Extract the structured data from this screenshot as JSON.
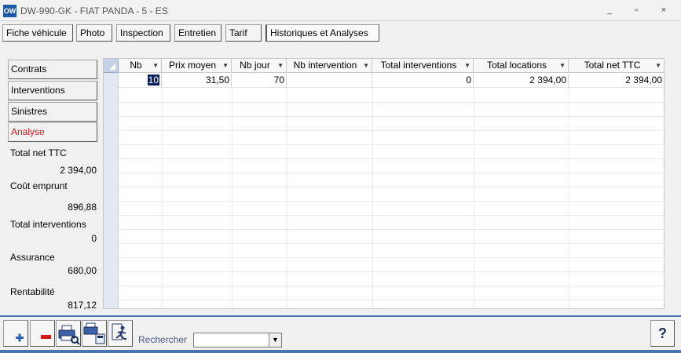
{
  "window": {
    "icon_label": "OW",
    "title": "DW-990-GK - FIAT PANDA - 5 - ES",
    "controls": [
      "_",
      "▫",
      "×"
    ]
  },
  "tabs": [
    {
      "label": "Fiche véhicule"
    },
    {
      "label": "Photo"
    },
    {
      "label": "Inspection"
    },
    {
      "label": "Entretien"
    },
    {
      "label": "Tarif"
    },
    {
      "label": "Historiques et Analyses"
    }
  ],
  "active_tab": "Historiques et Analyses",
  "side_buttons": [
    {
      "label": "Contrats"
    },
    {
      "label": "Interventions"
    },
    {
      "label": "Sinistres"
    },
    {
      "label": "Analyse"
    }
  ],
  "active_side_button": "Analyse",
  "summary": {
    "total_net_label": "Total net TTC",
    "total_net_value": "2 394,00",
    "cout_emprunt_label": "Coût emprunt",
    "cout_emprunt_value": "896,88",
    "total_interventions_label": "Total interventions",
    "total_interventions_value": "0",
    "assurance_label": "Assurance",
    "assurance_value": "680,00",
    "rentabilite_label": "Rentabilité",
    "rentabilite_value": "817,12"
  },
  "table": {
    "columns": [
      "Nb",
      "Prix moyen",
      "Nb jour",
      "Nb intervention",
      "Total interventions",
      "Total locations",
      "Total net TTC"
    ],
    "rows": [
      [
        "10",
        "31,50",
        "70",
        "",
        "0",
        "2 394,00",
        "2 394,00"
      ]
    ]
  },
  "toolbar": {
    "search_label": "Rechercher",
    "search_value": "",
    "help_label": "?"
  },
  "colors": {
    "accent": "#4a73b3",
    "active_side_text": "#d91515",
    "selection": "#0b1f5c"
  }
}
